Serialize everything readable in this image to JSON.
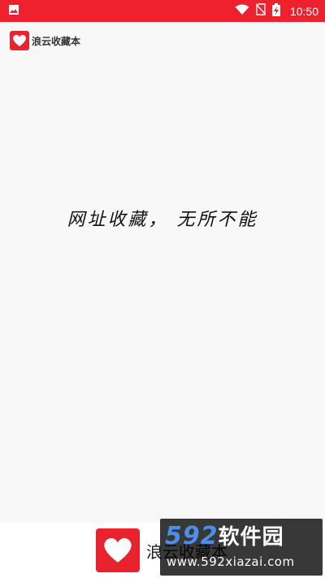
{
  "status_bar": {
    "time": "10:50",
    "icons": [
      "image-notification-icon",
      "wifi-icon",
      "no-sim-icon",
      "battery-charging-icon"
    ],
    "color": "#f0212e"
  },
  "header": {
    "app_name": "浪云收藏本",
    "logo_icon": "heart-icon"
  },
  "main": {
    "slogan": "网址收藏， 无所不能"
  },
  "footer": {
    "app_name": "浪云收藏本",
    "logo_icon": "heart-icon"
  },
  "watermark": {
    "brand_number": "592",
    "brand_text": "软件园",
    "url": "www.592xiazai.com"
  },
  "colors": {
    "accent": "#e8232e",
    "background": "#f8f8f8"
  }
}
